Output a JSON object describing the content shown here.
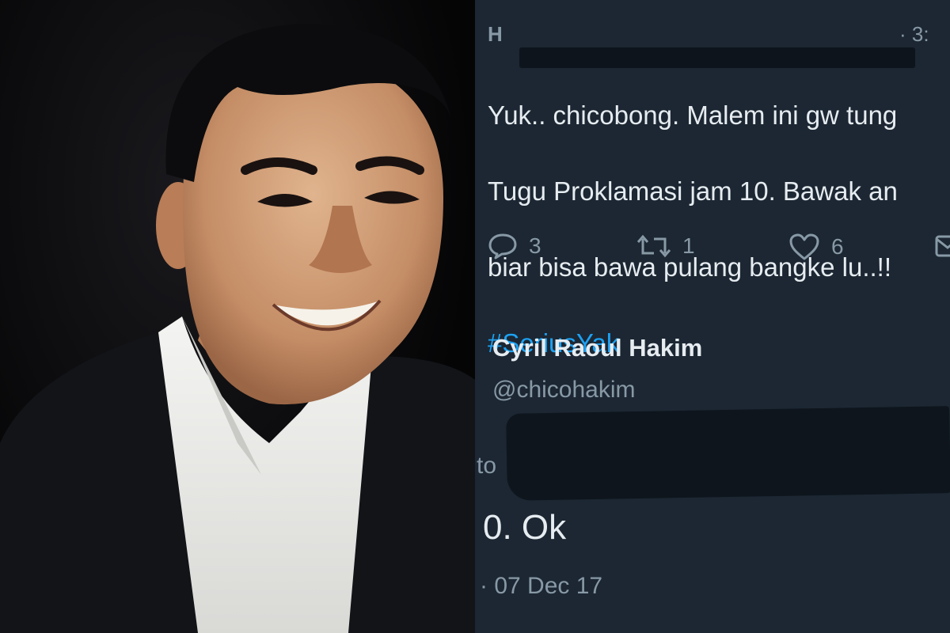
{
  "tweet": {
    "author_initial": "H",
    "time": "· 3:",
    "text_lines": [
      "Yuk.. chicobong. Malem ini gw tung",
      "Tugu Proklamasi jam 10. Bawak an",
      "biar bisa bawa pulang bangke lu..!!"
    ],
    "hashtag": "#SeriusYak",
    "reply_count": "3",
    "retweet_count": "1",
    "like_count": "6"
  },
  "reply": {
    "name": "Cyril Raoul Hakim",
    "handle": "@chicohakim",
    "to_label": "to",
    "text": "0. Ok",
    "date": "· 07 Dec 17"
  },
  "colors": {
    "panel_bg": "#1c2733",
    "text_primary": "#e6ecf0",
    "text_secondary": "#8899a6",
    "hashtag": "#1da1f2",
    "redaction": "#0d141b"
  },
  "icons": {
    "reply": "reply-icon",
    "retweet": "retweet-icon",
    "like": "heart-icon",
    "dm": "envelope-icon"
  }
}
